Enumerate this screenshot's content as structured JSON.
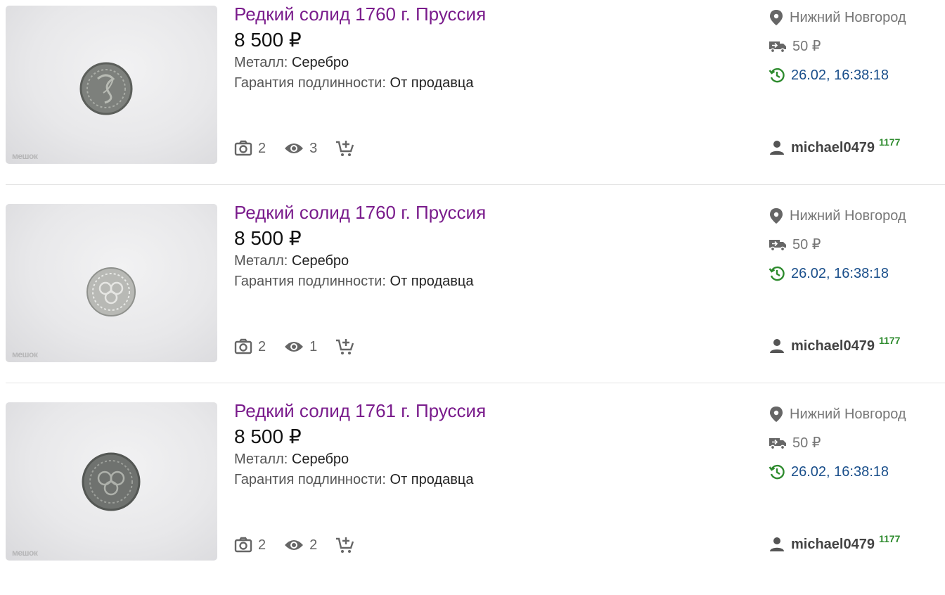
{
  "listings": [
    {
      "title": "Редкий солид 1760 г. Пруссия",
      "price": "8 500 ₽",
      "metal_label": "Металл:",
      "metal_value": "Серебро",
      "guarantee_label": "Гарантия подлинности:",
      "guarantee_value": "От продавца",
      "photos": "2",
      "views": "3",
      "location": "Нижний Новгород",
      "shipping": "50 ₽",
      "time": "26.02, 16:38:18",
      "seller": "michael0479",
      "rating": "1177",
      "watermark": "мешок"
    },
    {
      "title": "Редкий солид 1760 г. Пруссия",
      "price": "8 500 ₽",
      "metal_label": "Металл:",
      "metal_value": "Серебро",
      "guarantee_label": "Гарантия подлинности:",
      "guarantee_value": "От продавца",
      "photos": "2",
      "views": "1",
      "location": "Нижний Новгород",
      "shipping": "50 ₽",
      "time": "26.02, 16:38:18",
      "seller": "michael0479",
      "rating": "1177",
      "watermark": "мешок"
    },
    {
      "title": "Редкий солид 1761 г. Пруссия",
      "price": "8 500 ₽",
      "metal_label": "Металл:",
      "metal_value": "Серебро",
      "guarantee_label": "Гарантия подлинности:",
      "guarantee_value": "От продавца",
      "photos": "2",
      "views": "2",
      "location": "Нижний Новгород",
      "shipping": "50 ₽",
      "time": "26.02, 16:38:18",
      "seller": "michael0479",
      "rating": "1177",
      "watermark": "мешок"
    }
  ],
  "colors": {
    "title": "#7a1c8c",
    "time": "#1a4f8b",
    "time_icon": "#2e8b2e",
    "rating": "#2e8b2e",
    "icon_gray": "#666666"
  },
  "icons": {
    "location": "location-pin-icon",
    "shipping": "truck-icon",
    "time": "history-clock-icon",
    "seller": "user-icon",
    "photos": "camera-icon",
    "views": "eye-icon",
    "cart": "add-to-cart-icon"
  }
}
